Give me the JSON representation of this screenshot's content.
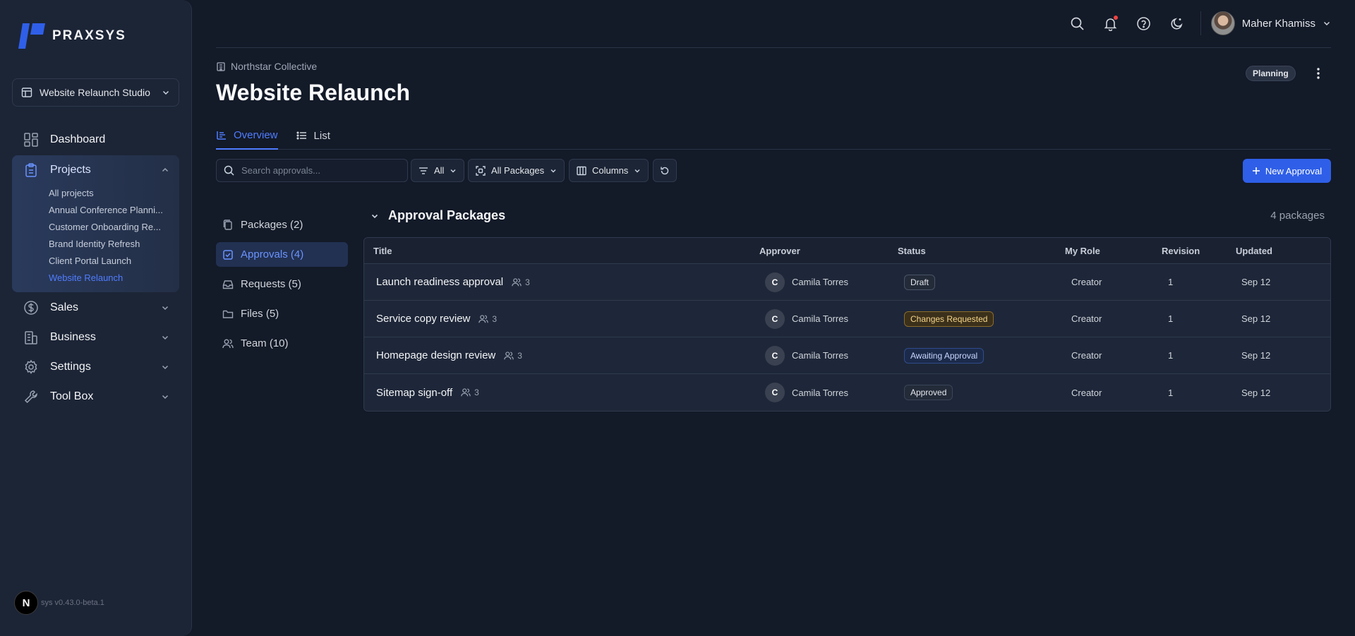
{
  "brand": {
    "name": "PRAXSYS",
    "accent": "#2f5fe8"
  },
  "workspace": {
    "label": "Website Relaunch Studio"
  },
  "nav": {
    "dashboard": "Dashboard",
    "projects": "Projects",
    "project_items": [
      "All projects",
      "Annual Conference Planni...",
      "Customer Onboarding Re...",
      "Brand Identity Refresh",
      "Client Portal Launch",
      "Website Relaunch"
    ],
    "sales": "Sales",
    "business": "Business",
    "settings": "Settings",
    "toolbox": "Tool Box"
  },
  "version": {
    "badge": "N",
    "text": "sys v0.43.0-beta.1"
  },
  "user": {
    "name": "Maher Khamiss"
  },
  "header": {
    "breadcrumb": "Northstar Collective",
    "title": "Website Relaunch",
    "status": "Planning"
  },
  "tabs": [
    "Overview",
    "List"
  ],
  "toolbar": {
    "search_placeholder": "Search approvals...",
    "filter_all": "All",
    "packages": "All Packages",
    "columns": "Columns",
    "new_approval": "New Approval"
  },
  "sections": [
    {
      "label": "Packages (2)",
      "icon": "packages-icon"
    },
    {
      "label": "Approvals (4)",
      "icon": "approvals-icon"
    },
    {
      "label": "Requests (5)",
      "icon": "inbox-icon"
    },
    {
      "label": "Files (5)",
      "icon": "folder-icon"
    },
    {
      "label": "Team (10)",
      "icon": "team-icon"
    }
  ],
  "table": {
    "title": "Approval Packages",
    "count": "4 packages",
    "columns": [
      "Title",
      "Approver",
      "Status",
      "My Role",
      "Revision",
      "Updated"
    ],
    "rows": [
      {
        "title": "Launch readiness approval",
        "members": "3",
        "approver_initial": "C",
        "approver": "Camila Torres",
        "status": "Draft",
        "role": "Creator",
        "revision": "1",
        "updated": "Sep 12"
      },
      {
        "title": "Service copy review",
        "members": "3",
        "approver_initial": "C",
        "approver": "Camila Torres",
        "status": "Changes Requested",
        "role": "Creator",
        "revision": "1",
        "updated": "Sep 12"
      },
      {
        "title": "Homepage design review",
        "members": "3",
        "approver_initial": "C",
        "approver": "Camila Torres",
        "status": "Awaiting Approval",
        "role": "Creator",
        "revision": "1",
        "updated": "Sep 12"
      },
      {
        "title": "Sitemap sign-off",
        "members": "3",
        "approver_initial": "C",
        "approver": "Camila Torres",
        "status": "Approved",
        "role": "Creator",
        "revision": "1",
        "updated": "Sep 12"
      }
    ]
  }
}
